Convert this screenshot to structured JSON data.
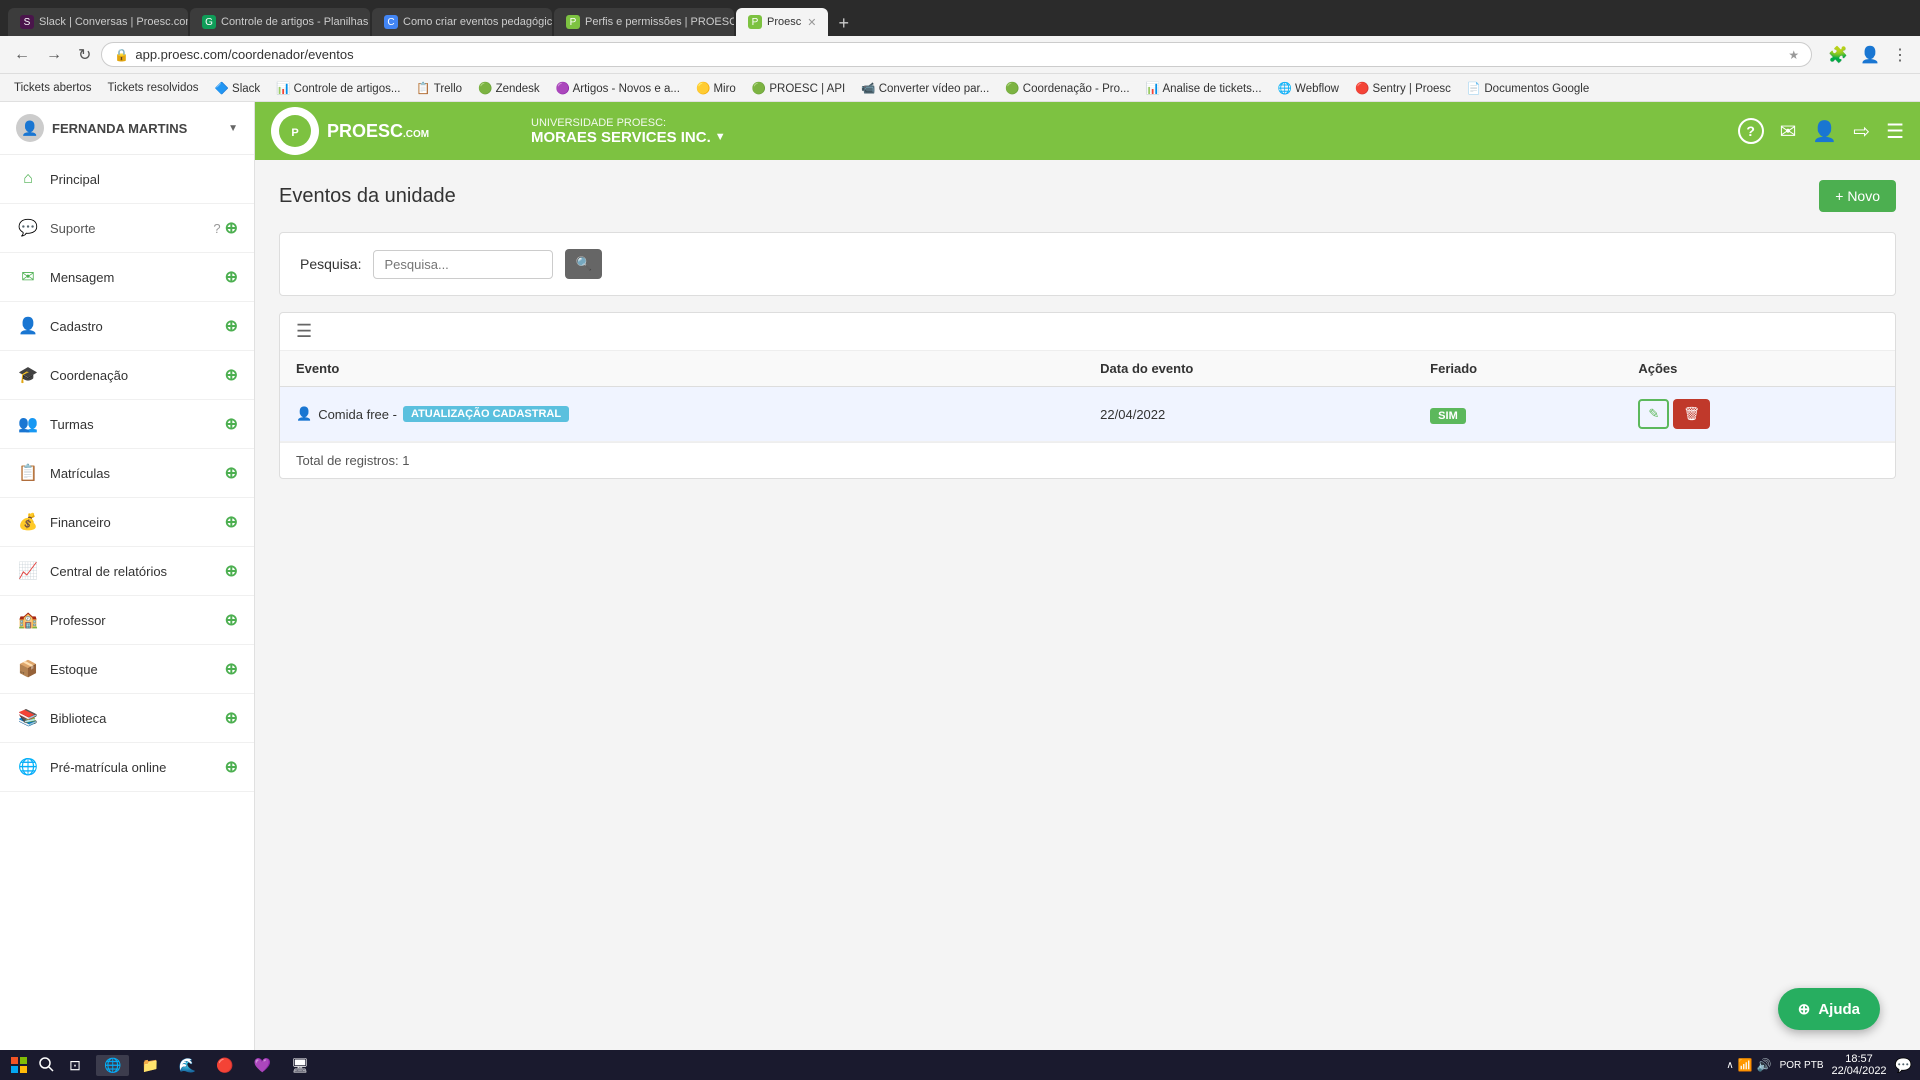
{
  "browser": {
    "tabs": [
      {
        "id": 1,
        "label": "Slack | Conversas | Proesc.com",
        "active": false,
        "icon": "S"
      },
      {
        "id": 2,
        "label": "Controle de artigos - Planilhas G...",
        "active": false,
        "icon": "G"
      },
      {
        "id": 3,
        "label": "Como criar eventos pedagógico...",
        "active": false,
        "icon": "C"
      },
      {
        "id": 4,
        "label": "Perfis e permissões | PROESC - ...",
        "active": false,
        "icon": "P"
      },
      {
        "id": 5,
        "label": "Proesc",
        "active": true,
        "icon": "P"
      }
    ],
    "address": "app.proesc.com/coordenador/eventos",
    "bookmarks": [
      "Tickets abertos",
      "Tickets resolvidos",
      "Slack",
      "Controle de artigos...",
      "Trello",
      "Zendesk",
      "Artigos - Novos e a...",
      "Miro",
      "PROESC | API",
      "Converter vídeo par...",
      "Coordenação - Pro...",
      "Analise de tickets...",
      "Webflow",
      "Sentry | Proesc",
      "Documentos Google"
    ]
  },
  "header": {
    "university_label": "UNIVERSIDADE PROESC:",
    "university_name": "MORAES SERVICES INC.",
    "help_icon": "?",
    "mail_icon": "✉",
    "user_icon": "👤",
    "logout_icon": "⇨",
    "menu_icon": "☰"
  },
  "sidebar": {
    "user_name": "FERNANDA MARTINS",
    "nav_items": [
      {
        "id": "principal",
        "label": "Principal",
        "icon": "⌂",
        "has_plus": false
      },
      {
        "id": "suporte",
        "label": "Suporte",
        "icon": "💬",
        "has_plus": true,
        "has_help": true
      },
      {
        "id": "mensagem",
        "label": "Mensagem",
        "icon": "✉",
        "has_plus": true
      },
      {
        "id": "cadastro",
        "label": "Cadastro",
        "icon": "👤",
        "has_plus": true
      },
      {
        "id": "coordenacao",
        "label": "Coordenação",
        "icon": "🎓",
        "has_plus": true
      },
      {
        "id": "turmas",
        "label": "Turmas",
        "icon": "👥",
        "has_plus": true
      },
      {
        "id": "matriculas",
        "label": "Matrículas",
        "icon": "📋",
        "has_plus": true
      },
      {
        "id": "financeiro",
        "label": "Financeiro",
        "icon": "💰",
        "has_plus": true
      },
      {
        "id": "central-relatorios",
        "label": "Central de relatórios",
        "icon": "📈",
        "has_plus": true
      },
      {
        "id": "professor",
        "label": "Professor",
        "icon": "🏫",
        "has_plus": true
      },
      {
        "id": "estoque",
        "label": "Estoque",
        "icon": "📦",
        "has_plus": true
      },
      {
        "id": "biblioteca",
        "label": "Biblioteca",
        "icon": "📚",
        "has_plus": true
      },
      {
        "id": "pre-matricula",
        "label": "Pré-matrícula online",
        "icon": "🌐",
        "has_plus": true
      }
    ]
  },
  "page": {
    "title": "Eventos da unidade",
    "novo_button": "+ Novo",
    "search": {
      "label": "Pesquisa:",
      "placeholder": "Pesquisa...",
      "button_icon": "🔍"
    },
    "table": {
      "columns": [
        "Evento",
        "Data do evento",
        "Feriado",
        "Ações"
      ],
      "rows": [
        {
          "event_name": "Comida free -",
          "badge_text": "ATUALIZAÇÃO CADASTRAL",
          "date": "22/04/2022",
          "feriado": "SIM",
          "has_edit": true,
          "has_delete": true
        }
      ],
      "total_label": "Total de registros:",
      "total_count": "1"
    }
  },
  "ajuda": {
    "label": "Ajuda"
  },
  "taskbar": {
    "time": "18:57",
    "date": "22/04/2022",
    "locale": "POR PTB"
  }
}
